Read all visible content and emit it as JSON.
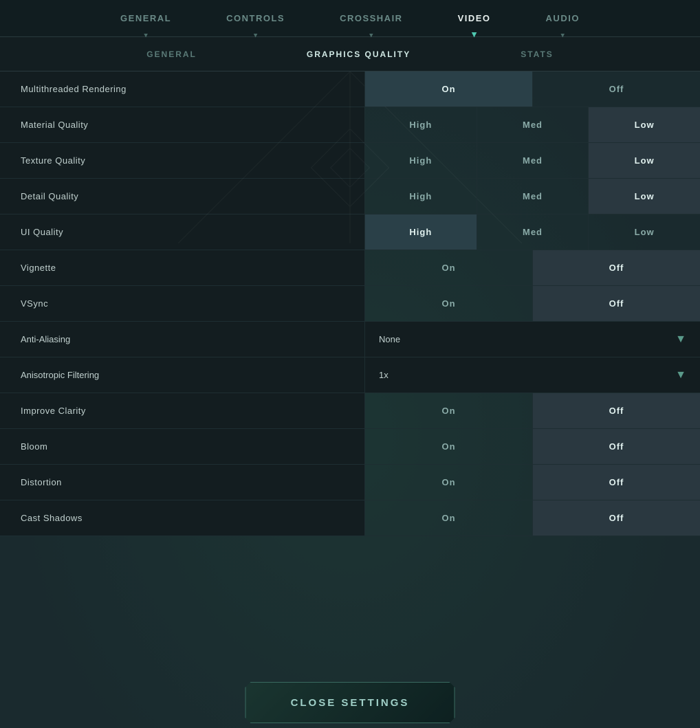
{
  "nav": {
    "items": [
      {
        "id": "general",
        "label": "GENERAL",
        "active": false
      },
      {
        "id": "controls",
        "label": "CONTROLS",
        "active": false
      },
      {
        "id": "crosshair",
        "label": "CROSSHAIR",
        "active": false
      },
      {
        "id": "video",
        "label": "VIDEO",
        "active": true
      },
      {
        "id": "audio",
        "label": "AUDIO",
        "active": false
      }
    ]
  },
  "subnav": {
    "items": [
      {
        "id": "general",
        "label": "GENERAL",
        "active": false
      },
      {
        "id": "graphics_quality",
        "label": "GRAPHICS QUALITY",
        "active": true
      },
      {
        "id": "stats",
        "label": "STATS",
        "active": false
      }
    ]
  },
  "settings": [
    {
      "label": "Multithreaded Rendering",
      "type": "toggle",
      "options": [
        "On",
        "Off"
      ],
      "selected": "On"
    },
    {
      "label": "Material Quality",
      "type": "triple",
      "options": [
        "High",
        "Med",
        "Low"
      ],
      "selected": "Low"
    },
    {
      "label": "Texture Quality",
      "type": "triple",
      "options": [
        "High",
        "Med",
        "Low"
      ],
      "selected": "Low"
    },
    {
      "label": "Detail Quality",
      "type": "triple",
      "options": [
        "High",
        "Med",
        "Low"
      ],
      "selected": "Low"
    },
    {
      "label": "UI Quality",
      "type": "triple",
      "options": [
        "High",
        "Med",
        "Low"
      ],
      "selected": "High"
    },
    {
      "label": "Vignette",
      "type": "toggle",
      "options": [
        "On",
        "Off"
      ],
      "selected": "Off"
    },
    {
      "label": "VSync",
      "type": "toggle",
      "options": [
        "On",
        "Off"
      ],
      "selected": "Off"
    },
    {
      "label": "Anti-Aliasing",
      "type": "dropdown",
      "value": "None"
    },
    {
      "label": "Anisotropic Filtering",
      "type": "dropdown",
      "value": "1x"
    },
    {
      "label": "Improve Clarity",
      "type": "toggle",
      "options": [
        "On",
        "Off"
      ],
      "selected": "Off"
    },
    {
      "label": "Bloom",
      "type": "toggle",
      "options": [
        "On",
        "Off"
      ],
      "selected": "Off"
    },
    {
      "label": "Distortion",
      "type": "toggle",
      "options": [
        "On",
        "Off"
      ],
      "selected": "Off"
    },
    {
      "label": "Cast Shadows",
      "type": "toggle",
      "options": [
        "On",
        "Off"
      ],
      "selected": "Off"
    }
  ],
  "close_button": {
    "label": "CLOSE SETTINGS"
  }
}
